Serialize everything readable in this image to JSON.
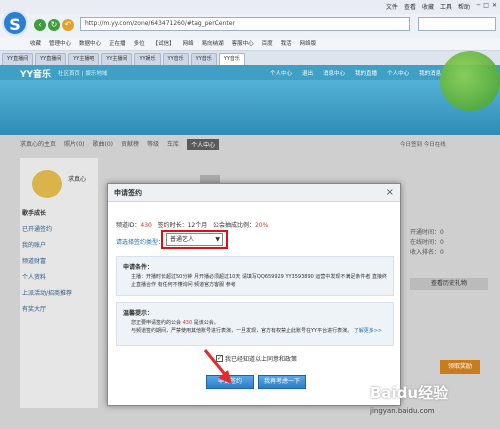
{
  "browser": {
    "menu": [
      "文件",
      "查看",
      "收藏",
      "工具",
      "帮助"
    ],
    "address": "http://m.yy.com/zone/643471260/#tag_perCenter",
    "favorites": [
      "收藏",
      "管理中心",
      "数据中心",
      "正在播",
      "多位",
      "【试信】",
      "网络",
      "易向纳湖",
      "客服中心",
      "百度",
      "我活",
      "网络版"
    ],
    "tabs": [
      "YY直播间",
      "YY直播间",
      "YY主播吧",
      "YY主播间",
      "YY娱乐",
      "YY音乐",
      "YY音乐",
      "YY音乐"
    ]
  },
  "site": {
    "brand": "YY音乐",
    "sub_links": "社区首页 | 娱乐地域",
    "header_links": [
      "个人中心",
      "退出",
      "消息中心",
      "我的直播",
      "我的家乡",
      "我们一起",
      "个人中心",
      "我的消息"
    ]
  },
  "profile": {
    "tabs": [
      "求真心的主页",
      "照片(0)",
      "歌曲(0)",
      "贡献榜",
      "等级",
      "车库",
      "个人中心"
    ],
    "active_tab": "个人中心",
    "top_right": "今日签到  今日在线",
    "username": "求真心",
    "side": [
      "歌手成长",
      "已开通签约",
      "我的账户",
      "频道财富",
      "个人资料",
      "上派活动/招商推荐",
      "有奖大厅"
    ],
    "stats": [
      "开通时间：0",
      "在线时间：0",
      "收入排名：0"
    ],
    "gift_btn": "查看历史礼物",
    "play_btn": "领取奖励"
  },
  "dialog": {
    "title": "申请签约",
    "channel_label": "频道ID：",
    "channel_id": "430",
    "duration_label": "签约时长：",
    "duration": "12个月",
    "ratio_label": "公会抽成比例：",
    "ratio": "20%",
    "type_label": "请选择签约类型：",
    "type_value": "普通艺人",
    "cond_title": "申请条件：",
    "cond_text": "主播：开播时长超过50分钟 月开播必须超过10天 请填写QQ659929 YY3593890 运营中发现不满足条件者 直接终止直播合作 有任何不懂询问 频道官方客服 参考",
    "tip_title": "温馨提示：",
    "tip_text_1": "您正要申请签约的公会",
    "tip_id": "430",
    "tip_text_2": "是该公会。",
    "tip_text_3": "与频道签约期间，严禁使用其他账号进行表演，一旦发现，官方有权禁止此账号在YY平台进行表演。",
    "tip_more": "了解更多>>",
    "agree_text": "我已经知道以上同意和政策",
    "apply_btn": "申请签约",
    "later_btn": "我再考虑一下"
  },
  "watermark": {
    "brand": "Baidu经验",
    "url": "jingyan.baidu.com"
  }
}
